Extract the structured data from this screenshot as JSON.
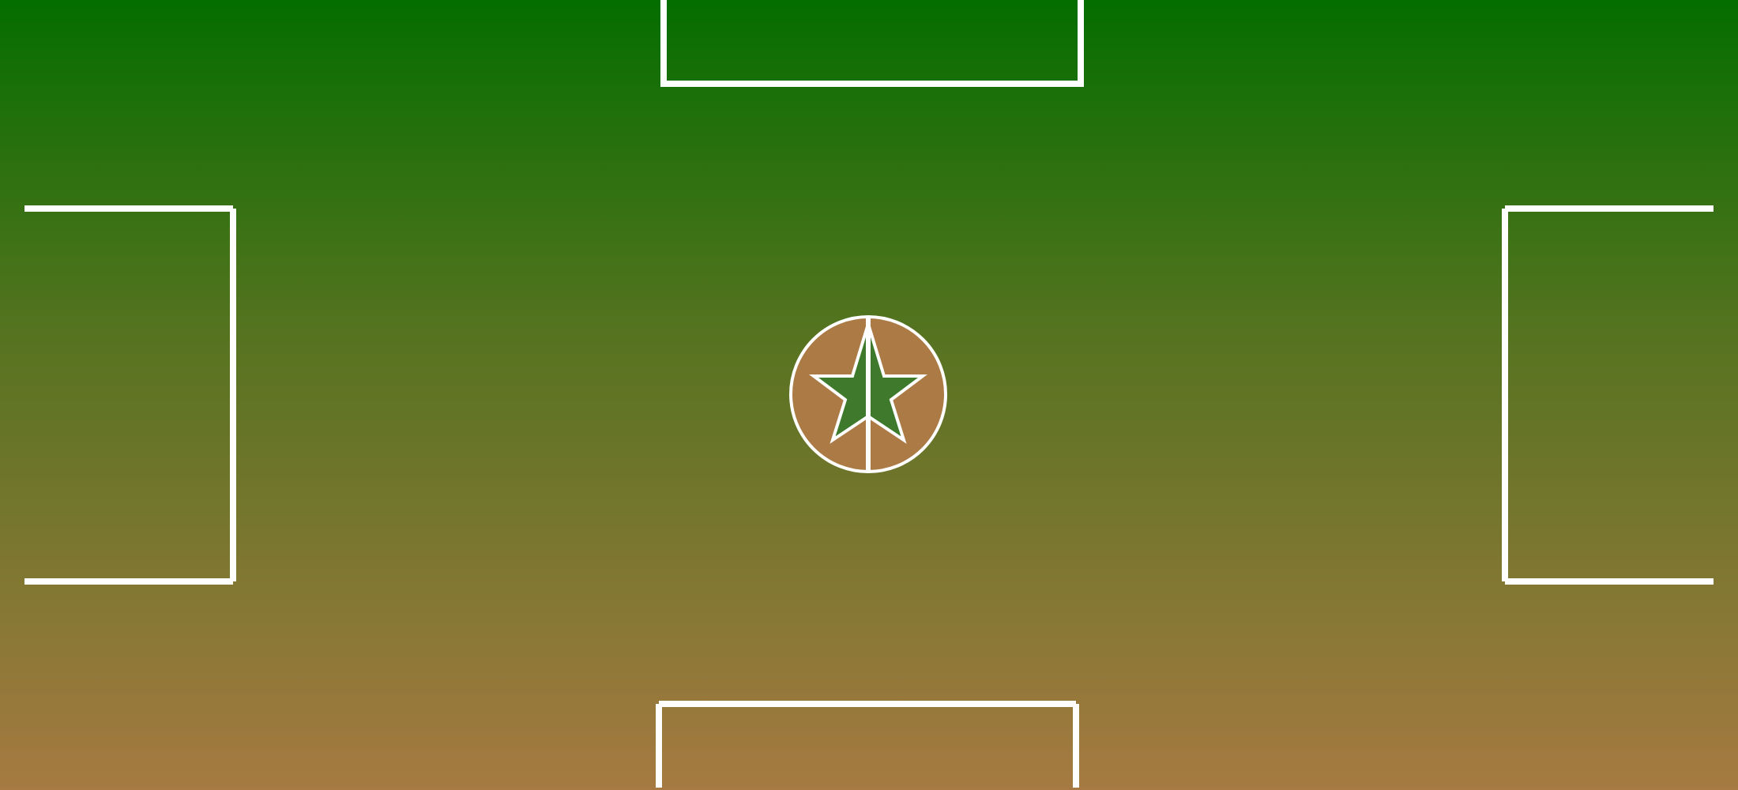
{
  "field": {
    "colors": {
      "top": "#046E00",
      "middle": "#557320",
      "bottom": "#A67A42",
      "lines": "#FFFFFF",
      "center_disc": "#AB7A45",
      "star_fill": "#3F7A2C"
    },
    "markings": [
      "goal-box-top",
      "goal-box-bottom",
      "goal-box-left",
      "goal-box-right",
      "center-circle",
      "center-star",
      "center-line"
    ]
  }
}
